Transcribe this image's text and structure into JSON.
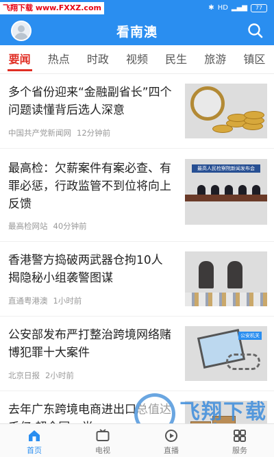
{
  "statusbar": {
    "watermark_tag": "飞翔下载 www.FXXZ.com",
    "battery": "77"
  },
  "header": {
    "title": "看南澳"
  },
  "tabs": [
    {
      "label": "要闻",
      "active": true
    },
    {
      "label": "热点"
    },
    {
      "label": "时政"
    },
    {
      "label": "视频"
    },
    {
      "label": "民生"
    },
    {
      "label": "旅游"
    },
    {
      "label": "镇区"
    }
  ],
  "news": [
    {
      "title": "多个省份迎来“金融副省长”四个问题读懂背后选人深意",
      "source": "中国共产党新闻网",
      "time": "12分钟前",
      "thumb_icon": "coins-magnifier-image"
    },
    {
      "title": "最高检：欠薪案件有案必查、有罪必惩，行政监管不到位将向上反馈",
      "source": "最高检网站",
      "time": "40分钟前",
      "thumb_icon": "press-conference-image",
      "thumb_banner": "最高人民检察院新闻发布会"
    },
    {
      "title": "香港警方捣破两武器仓拘10人 揭隐秘小组袭警图谋",
      "source": "直通粤港澳",
      "time": "1小时前",
      "thumb_icon": "police-seizure-image"
    },
    {
      "title": "公安部发布严打整治跨境网络赌博犯罪十大案件",
      "source": "北京日报",
      "time": "2小时前",
      "thumb_icon": "gambling-cartoon-image",
      "thumb_tag": "公安机关"
    },
    {
      "title": "去年广东跨境电商进出口总值达千亿 超全国一半",
      "source": "",
      "time": "",
      "thumb_icon": "warehouse-image"
    }
  ],
  "bottom_nav": [
    {
      "label": "首页",
      "icon": "home-icon",
      "active": true
    },
    {
      "label": "电视",
      "icon": "tv-icon"
    },
    {
      "label": "直播",
      "icon": "live-icon"
    },
    {
      "label": "服务",
      "icon": "service-icon"
    }
  ],
  "watermark": {
    "text": "飞翔下载",
    "url": "www.fxxz.com"
  },
  "colors": {
    "primary": "#2a8ef0",
    "accent_red": "#e02e24"
  }
}
